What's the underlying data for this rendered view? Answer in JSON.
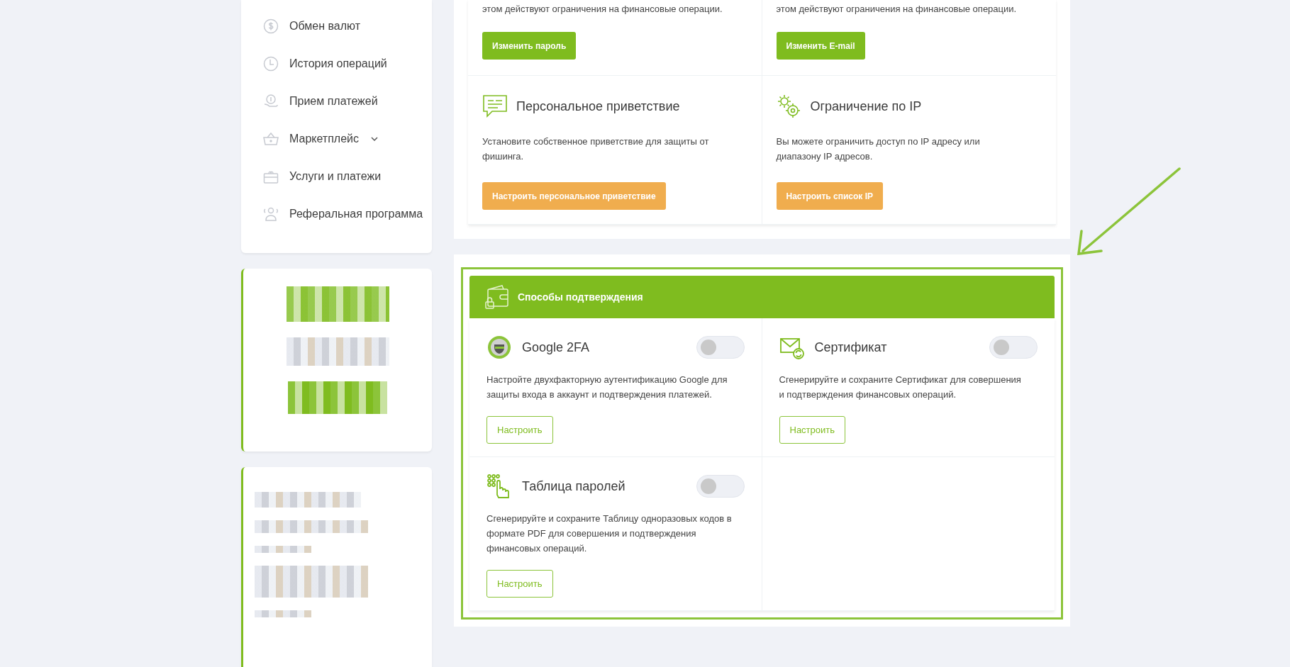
{
  "sidebar": {
    "items": [
      {
        "label": "Обмен валют",
        "has_submenu": false
      },
      {
        "label": "История операций",
        "has_submenu": false
      },
      {
        "label": "Прием платежей",
        "has_submenu": false
      },
      {
        "label": "Маркетплейс",
        "has_submenu": true
      },
      {
        "label": "Услуги и платежи",
        "has_submenu": false
      },
      {
        "label": "Реферальная программа",
        "has_submenu": false
      }
    ]
  },
  "security": {
    "cells": [
      {
        "description": "этом действуют ограничения на финансовые операции.",
        "button": "Изменить пароль",
        "kind": "primary"
      },
      {
        "description": "этом действуют ограничения на финансовые операции.",
        "button": "Изменить E-mail",
        "kind": "primary"
      },
      {
        "title": "Персональное приветствие",
        "description": "Установите собственное приветствие для защиты от фишинга.",
        "button": "Настроить персональное приветствие",
        "kind": "warning"
      },
      {
        "title": "Ограничение по IP",
        "description": "Вы можете ограничить доступ по IP адресу или диапазону IP адресов.",
        "button": "Настроить список IP",
        "kind": "warning"
      }
    ]
  },
  "confirmation": {
    "title": "Способы подтверждения",
    "methods": [
      {
        "title": "Google 2FA",
        "on": false,
        "description": "Настройте двухфакторную аутентификацию Google для защиты входа в аккаунт и подтверждения платежей.",
        "button": "Настроить"
      },
      {
        "title": "Сертификат",
        "on": false,
        "description": "Сгенерируйте и сохраните Сертификат для совершения и подтверждения финансовых операций.",
        "button": "Настроить"
      },
      {
        "title": "Таблица паролей",
        "on": false,
        "description": "Сгенерируйте и сохраните Таблицу одноразовых кодов в формате PDF для совершения и подтверждения финансовых операций.",
        "button": "Настроить"
      }
    ]
  }
}
